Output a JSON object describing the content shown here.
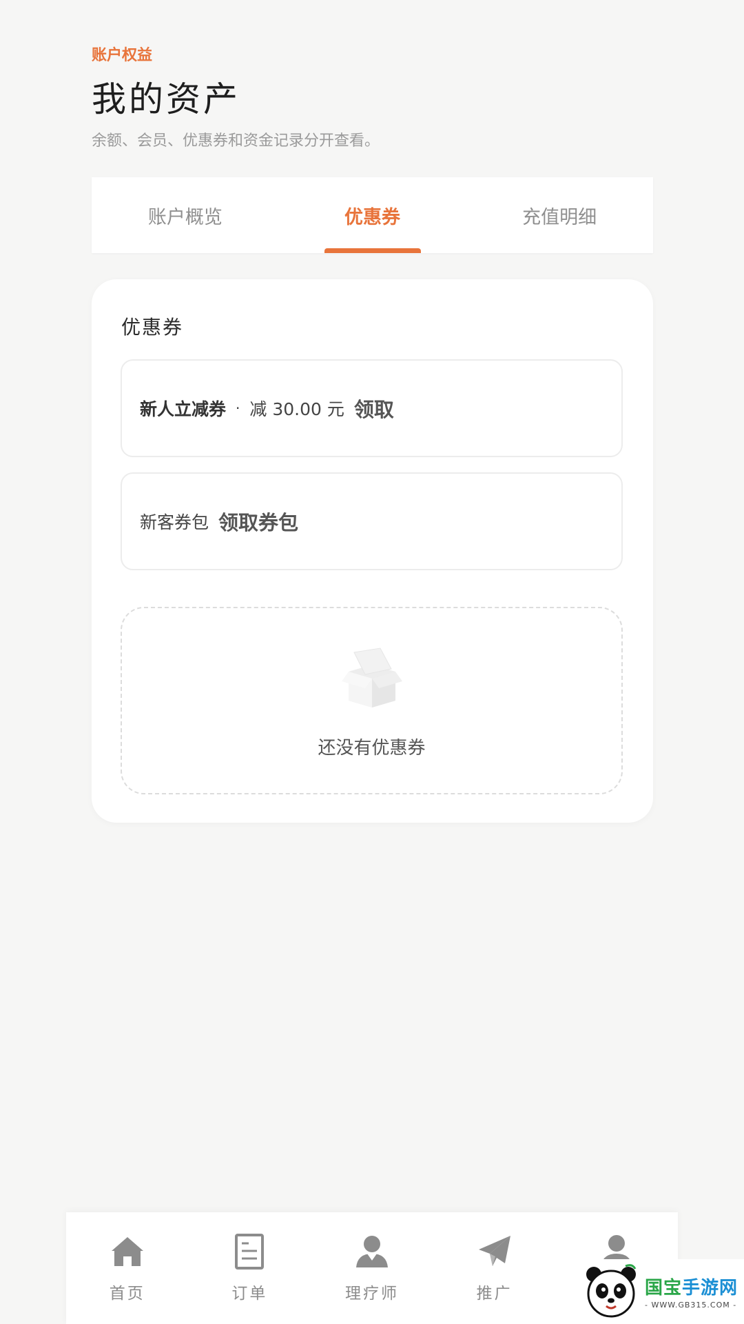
{
  "header": {
    "eyebrow": "账户权益",
    "title": "我的资产",
    "subtitle": "余额、会员、优惠券和资金记录分开查看。"
  },
  "tabs": [
    {
      "label": "账户概览",
      "active": false
    },
    {
      "label": "优惠券",
      "active": true
    },
    {
      "label": "充值明细",
      "active": false
    }
  ],
  "coupons": {
    "section_title": "优惠券",
    "items": [
      {
        "name": "新人立减券",
        "separator": "·",
        "desc": "减 30.00 元",
        "action": "领取"
      },
      {
        "name": "新客券包",
        "action": "领取券包"
      }
    ],
    "empty_text": "还没有优惠券"
  },
  "bottom_nav": {
    "items": [
      {
        "label": "首页",
        "icon": "home-icon"
      },
      {
        "label": "订单",
        "icon": "document-icon"
      },
      {
        "label": "理疗师",
        "icon": "therapist-icon"
      },
      {
        "label": "推广",
        "icon": "paper-plane-icon"
      },
      {
        "label": "",
        "icon": "profile-icon"
      }
    ]
  },
  "watermark": {
    "name_part1": "国宝",
    "name_part2": "手游网",
    "url": "- WWW.GB315.COM -"
  },
  "colors": {
    "accent": "#e8743b",
    "background": "#f6f6f5",
    "nav_icon": "#8c8c8c"
  }
}
